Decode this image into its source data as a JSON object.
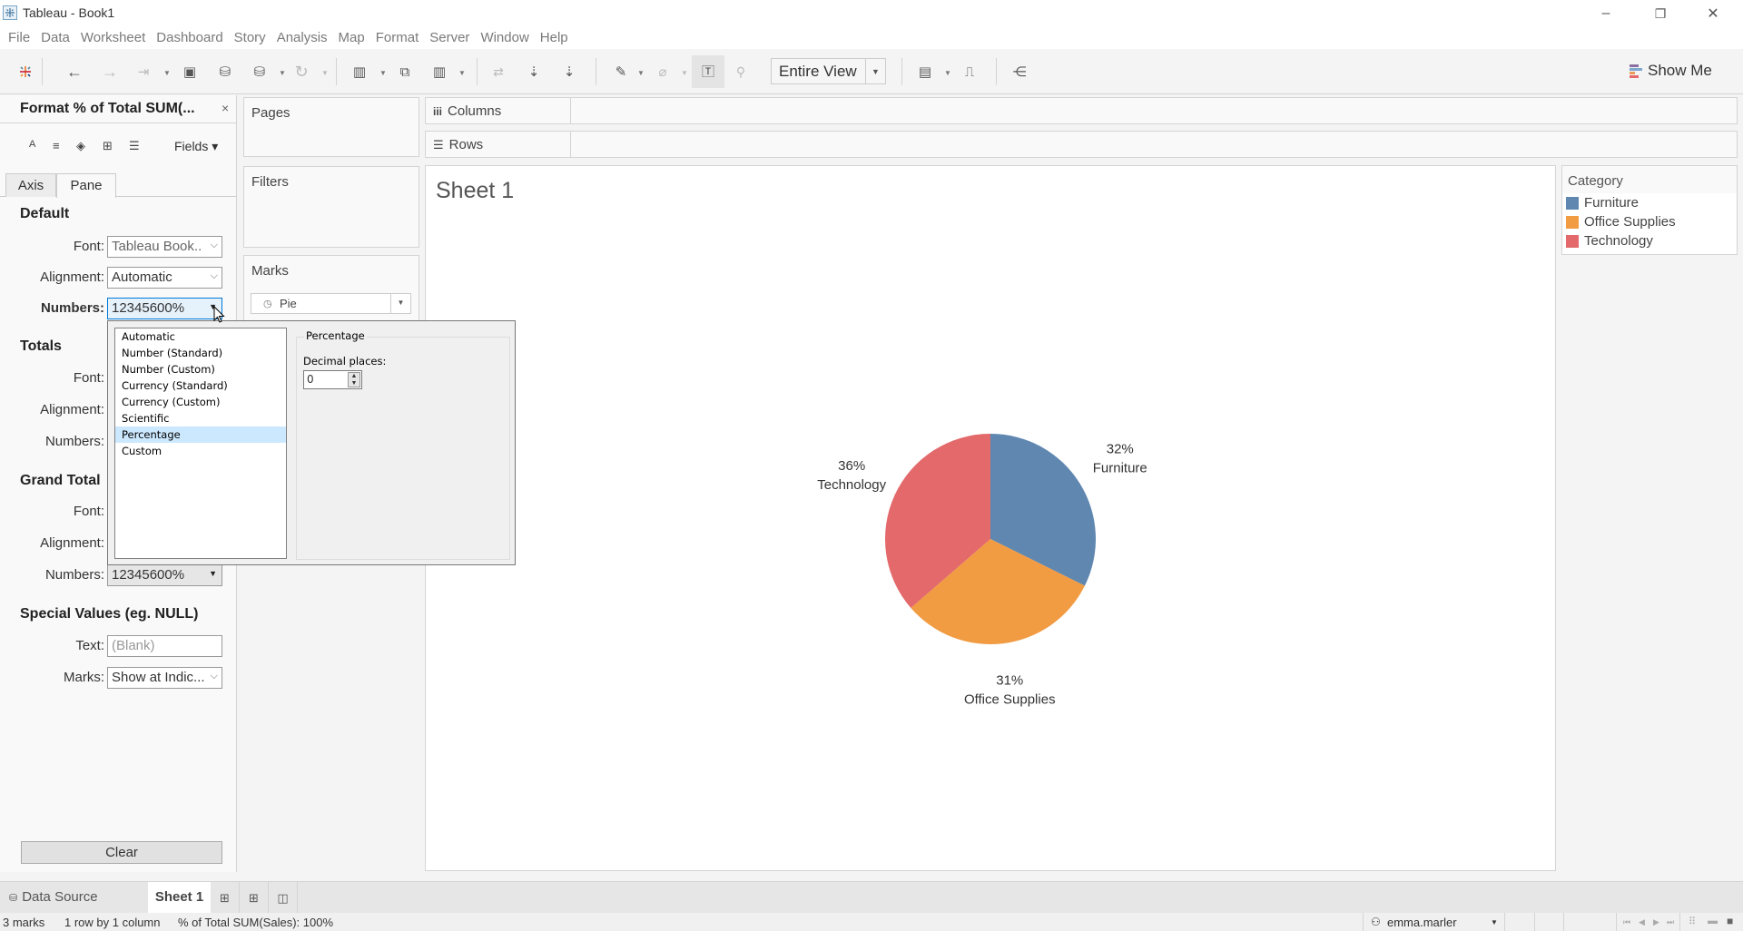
{
  "window": {
    "title": "Tableau - Book1",
    "minimize": "–",
    "restore": "❐",
    "close": "✕"
  },
  "menu": [
    "File",
    "Data",
    "Worksheet",
    "Dashboard",
    "Story",
    "Analysis",
    "Map",
    "Format",
    "Server",
    "Window",
    "Help"
  ],
  "toolbar": {
    "fit": "Entire View",
    "show_me": "Show Me"
  },
  "format_pane": {
    "title": "Format % of Total SUM(...",
    "close": "×",
    "fields": "Fields ▾",
    "tabs": [
      "Axis",
      "Pane"
    ],
    "active_tab": "Pane",
    "default": {
      "title": "Default",
      "font_label": "Font:",
      "font_value": "Tableau Book..",
      "alignment_label": "Alignment:",
      "alignment_value": "Automatic",
      "numbers_label": "Numbers:",
      "numbers_value": "12345600%"
    },
    "totals": {
      "title": "Totals",
      "font_label": "Font:",
      "alignment_label": "Alignment:",
      "numbers_label": "Numbers:"
    },
    "grand_totals": {
      "title": "Grand Total",
      "font_label": "Font:",
      "alignment_label": "Alignment:",
      "numbers_label": "Numbers:",
      "numbers_value": "12345600%"
    },
    "special": {
      "title": "Special Values (eg. NULL)",
      "text_label": "Text:",
      "text_placeholder": "(Blank)",
      "marks_label": "Marks:",
      "marks_value": "Show at Indic..."
    },
    "clear": "Clear"
  },
  "number_popup": {
    "options": [
      "Automatic",
      "Number (Standard)",
      "Number (Custom)",
      "Currency (Standard)",
      "Currency (Custom)",
      "Scientific",
      "Percentage",
      "Custom"
    ],
    "selected": "Percentage",
    "group_title": "Percentage",
    "decimal_label": "Decimal places:",
    "decimal_value": "0"
  },
  "shelves": {
    "pages": "Pages",
    "filters": "Filters",
    "marks": "Marks",
    "mark_type": "Pie",
    "columns": "Columns",
    "rows": "Rows"
  },
  "sheet": {
    "title": "Sheet 1"
  },
  "legend": {
    "title": "Category",
    "items": [
      {
        "label": "Furniture",
        "color": "#5f87b0"
      },
      {
        "label": "Office Supplies",
        "color": "#f19b42"
      },
      {
        "label": "Technology",
        "color": "#e3696b"
      }
    ]
  },
  "chart_data": {
    "type": "pie",
    "title": "Sheet 1",
    "categories": [
      "Furniture",
      "Office Supplies",
      "Technology"
    ],
    "values": [
      32,
      31,
      36
    ],
    "value_labels": [
      "32%",
      "31%",
      "36%"
    ],
    "colors": [
      "#5f87b0",
      "#f19b42",
      "#e3696b"
    ],
    "start_angle_deg": 0,
    "direction": "clockwise",
    "legend": "right"
  },
  "bottom_tabs": {
    "data_source": "Data Source",
    "sheet": "Sheet 1"
  },
  "status": {
    "marks": "3 marks",
    "dims": "1 row by 1 column",
    "summary": "% of Total SUM(Sales): 100%",
    "user": "emma.marler"
  }
}
